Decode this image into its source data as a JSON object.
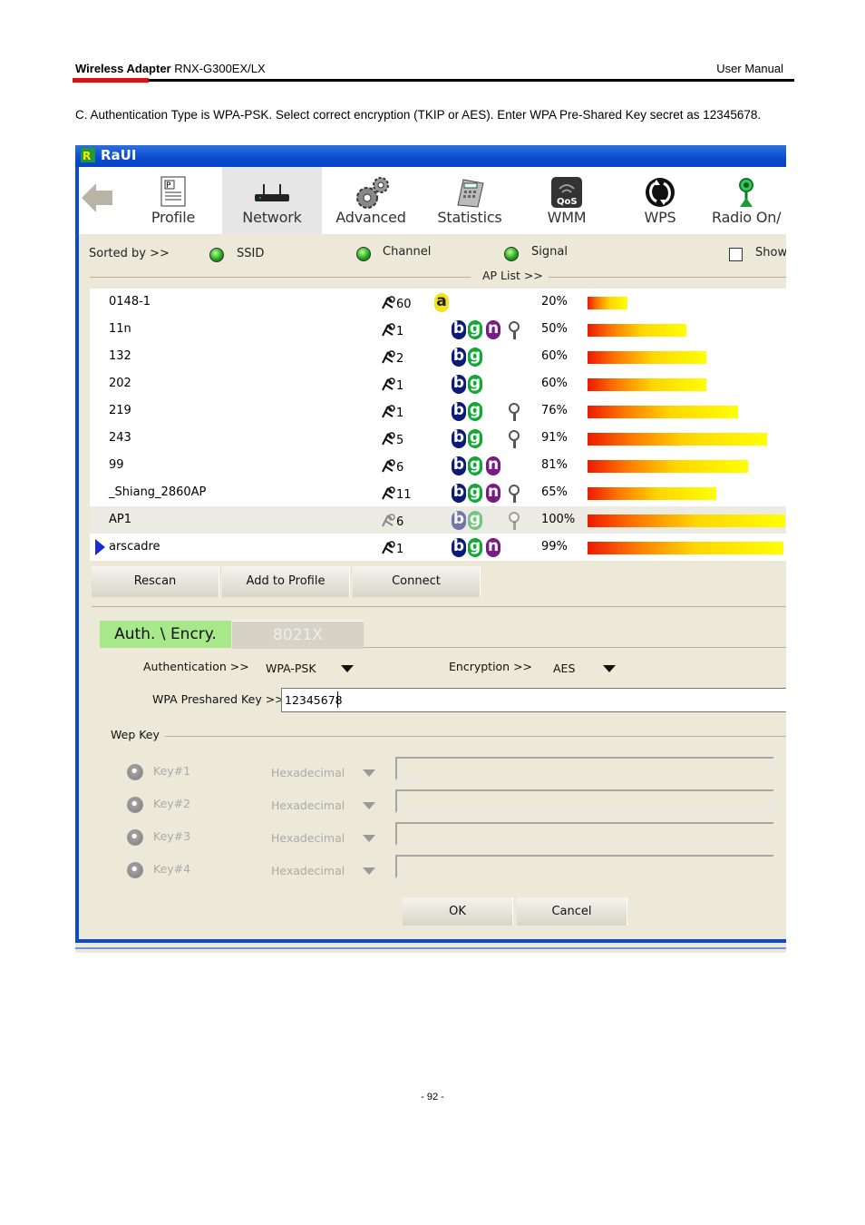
{
  "doc_header": {
    "product_bold": "Wireless Adapter",
    "product_model": " RNX-G300EX/LX",
    "manual": "User Manual"
  },
  "intro": "C. Authentication Type is WPA-PSK. Select correct encryption (TKIP or AES). Enter WPA Pre-Shared Key secret as 12345678.",
  "footer": "- 92 -",
  "window": {
    "title": "RaUI",
    "toolbar": [
      {
        "label": "Profile",
        "icon": "profile-icon"
      },
      {
        "label": "Network",
        "icon": "network-icon"
      },
      {
        "label": "Advanced",
        "icon": "advanced-icon"
      },
      {
        "label": "Statistics",
        "icon": "statistics-icon"
      },
      {
        "label": "WMM",
        "icon": "wmm-qos-icon"
      },
      {
        "label": "WPS",
        "icon": "wps-icon"
      },
      {
        "label": "Radio On/",
        "icon": "radio-icon"
      }
    ],
    "sortbar": {
      "sorted_by": "Sorted by >>",
      "ssid": "SSID",
      "channel": "Channel",
      "signal": "Signal",
      "show": "Show",
      "ap_list": "AP List >>"
    },
    "ap_list": [
      {
        "ssid": "0148-1",
        "channel": "60",
        "modes": [
          "a"
        ],
        "lock": false,
        "signal": 20,
        "signal_text": "20%"
      },
      {
        "ssid": "11n",
        "channel": "1",
        "modes": [
          "b",
          "g",
          "n"
        ],
        "lock": true,
        "signal": 50,
        "signal_text": "50%"
      },
      {
        "ssid": "132",
        "channel": "2",
        "modes": [
          "b",
          "g"
        ],
        "lock": false,
        "signal": 60,
        "signal_text": "60%"
      },
      {
        "ssid": "202",
        "channel": "1",
        "modes": [
          "b",
          "g"
        ],
        "lock": false,
        "signal": 60,
        "signal_text": "60%"
      },
      {
        "ssid": "219",
        "channel": "1",
        "modes": [
          "b",
          "g"
        ],
        "lock": true,
        "signal": 76,
        "signal_text": "76%"
      },
      {
        "ssid": "243",
        "channel": "5",
        "modes": [
          "b",
          "g"
        ],
        "lock": true,
        "signal": 91,
        "signal_text": "91%"
      },
      {
        "ssid": "99",
        "channel": "6",
        "modes": [
          "b",
          "g",
          "n"
        ],
        "lock": false,
        "signal": 81,
        "signal_text": "81%"
      },
      {
        "ssid": "_Shiang_2860AP",
        "channel": "11",
        "modes": [
          "b",
          "g",
          "n"
        ],
        "lock": true,
        "signal": 65,
        "signal_text": "65%"
      },
      {
        "ssid": "AP1",
        "channel": "6",
        "modes": [
          "b",
          "g"
        ],
        "lock": true,
        "signal": 100,
        "signal_text": "100%",
        "selected": true
      },
      {
        "ssid": "arscadre",
        "channel": "1",
        "modes": [
          "b",
          "g",
          "n"
        ],
        "lock": false,
        "signal": 99,
        "signal_text": "99%",
        "connected": true
      }
    ],
    "buttons": {
      "rescan": "Rescan",
      "add_profile": "Add to Profile",
      "connect": "Connect"
    },
    "tabs": {
      "auth": "Auth. \\ Encry.",
      "dot1x": "8021X"
    },
    "auth": {
      "auth_label": "Authentication >>",
      "auth_value": "WPA-PSK",
      "enc_label": "Encryption >>",
      "enc_value": "AES",
      "psk_label": "WPA Preshared Key >>",
      "psk_value": "12345678"
    },
    "wep": {
      "title": "Wep Key",
      "keys": [
        {
          "label": "Key#1",
          "format": "Hexadecimal"
        },
        {
          "label": "Key#2",
          "format": "Hexadecimal"
        },
        {
          "label": "Key#3",
          "format": "Hexadecimal"
        },
        {
          "label": "Key#4",
          "format": "Hexadecimal"
        }
      ]
    },
    "ok": "OK",
    "cancel": "Cancel"
  }
}
